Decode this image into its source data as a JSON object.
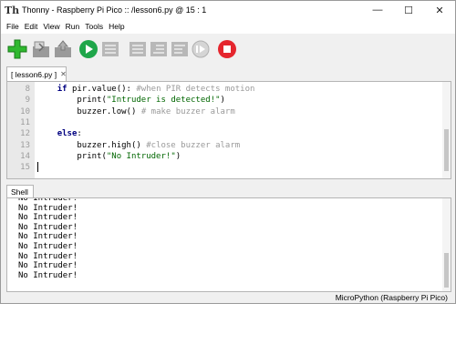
{
  "window": {
    "title": "Thonny  -  Raspberry Pi Pico :: /lesson6.py  @  15 : 1",
    "minimize_glyph": "—",
    "maximize_glyph": "☐",
    "close_glyph": "✕",
    "app_icon_glyph": "Th"
  },
  "menu": {
    "items": [
      {
        "label": "File"
      },
      {
        "label": "Edit"
      },
      {
        "label": "View"
      },
      {
        "label": "Run"
      },
      {
        "label": "Tools"
      },
      {
        "label": "Help"
      }
    ]
  },
  "toolbar": {
    "buttons": [
      {
        "name": "new-file",
        "icon": "plus-icon",
        "color": "#2fb82f",
        "enabled": true
      },
      {
        "name": "open-file",
        "icon": "folder-icon",
        "enabled": false
      },
      {
        "name": "save-file",
        "icon": "save-icon",
        "enabled": false
      },
      {
        "name": "run",
        "icon": "play-icon",
        "color": "#1fa64a",
        "enabled": true
      },
      {
        "name": "debug",
        "icon": "debug-icon",
        "enabled": false
      },
      {
        "name": "step-over",
        "icon": "step-over-icon",
        "enabled": false
      },
      {
        "name": "step-into",
        "icon": "step-into-icon",
        "enabled": false
      },
      {
        "name": "step-out",
        "icon": "step-out-icon",
        "enabled": false
      },
      {
        "name": "resume",
        "icon": "resume-icon",
        "enabled": false
      },
      {
        "name": "stop",
        "icon": "stop-icon",
        "color": "#e5262e",
        "enabled": true
      }
    ]
  },
  "editor": {
    "tab_label": "[ lesson6.py ]",
    "tab_close": "✕",
    "line_numbers": [
      "8",
      "9",
      "10",
      "11",
      "12",
      "13",
      "14",
      "15"
    ],
    "lines": [
      {
        "indent": "    ",
        "segs": [
          {
            "t": "if",
            "c": "kw"
          },
          {
            "t": " pir.value(): ",
            "c": ""
          },
          {
            "t": "#when PIR detects motion",
            "c": "cmt"
          }
        ]
      },
      {
        "indent": "        ",
        "segs": [
          {
            "t": "print(",
            "c": ""
          },
          {
            "t": "\"Intruder is detected!\"",
            "c": "str"
          },
          {
            "t": ")",
            "c": ""
          }
        ]
      },
      {
        "indent": "        ",
        "segs": [
          {
            "t": "buzzer.low() ",
            "c": ""
          },
          {
            "t": "# make buzzer alarm",
            "c": "cmt"
          }
        ]
      },
      {
        "indent": "",
        "segs": []
      },
      {
        "indent": "    ",
        "segs": [
          {
            "t": "else",
            "c": "kw"
          },
          {
            "t": ":",
            "c": ""
          }
        ]
      },
      {
        "indent": "        ",
        "segs": [
          {
            "t": "buzzer.high() ",
            "c": ""
          },
          {
            "t": "#close buzzer alarm",
            "c": "cmt"
          }
        ]
      },
      {
        "indent": "        ",
        "segs": [
          {
            "t": "print(",
            "c": ""
          },
          {
            "t": "\"No Intruder!\"",
            "c": "str"
          },
          {
            "t": ")",
            "c": ""
          }
        ]
      },
      {
        "indent": "",
        "segs": []
      }
    ],
    "colors": {
      "keyword": "#000080",
      "string": "#006600",
      "comment": "#9a9a9a"
    }
  },
  "shell": {
    "tab_label": "Shell",
    "lines": [
      "No Intruder!",
      "No Intruder!",
      "No Intruder!",
      "No Intruder!",
      "No Intruder!",
      "No Intruder!",
      "No Intruder!",
      "No Intruder!",
      "No Intruder!"
    ]
  },
  "status": {
    "interpreter": "MicroPython (Raspberry Pi Pico)"
  }
}
